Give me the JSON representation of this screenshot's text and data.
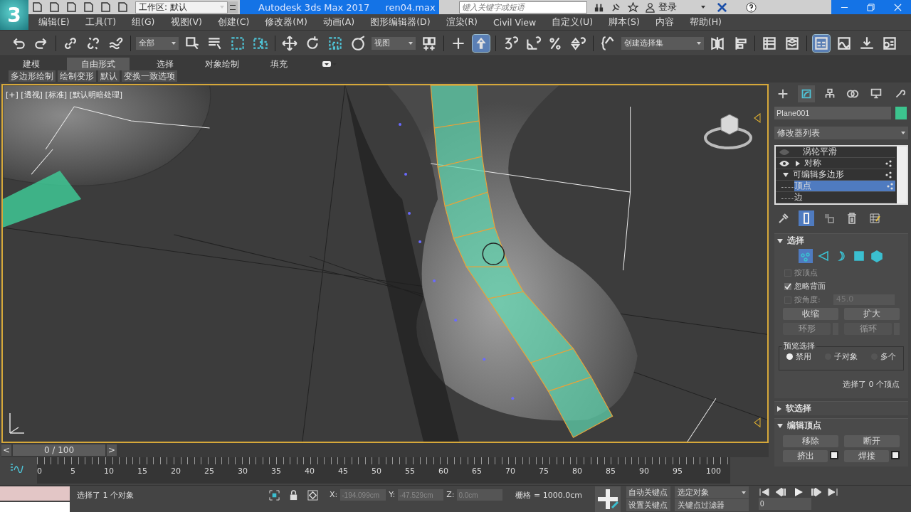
{
  "title_bar": {
    "logo": "3",
    "workspace": "工作区: 默认",
    "app_title": "Autodesk 3ds Max 2017",
    "file_name": "ren04.max",
    "search_placeholder": "键入关键字或短语",
    "login": "登录"
  },
  "menu": [
    "编辑(E)",
    "工具(T)",
    "组(G)",
    "视图(V)",
    "创建(C)",
    "修改器(M)",
    "动画(A)",
    "图形编辑器(D)",
    "渲染(R)",
    "Civil View",
    "自定义(U)",
    "脚本(S)",
    "内容",
    "帮助(H)"
  ],
  "toolbar": {
    "selection_filter": "全部",
    "reference_coordinates": "视图",
    "named_selection": "创建选择集",
    "keyboard_override": {
      "on": true
    },
    "ribbon_toggle": {
      "on": true
    }
  },
  "ribbon_tabs": [
    {
      "label": "建模",
      "selected": false
    },
    {
      "label": "自由形式",
      "selected": true
    },
    {
      "label": "选择",
      "selected": false
    },
    {
      "label": "对象绘制",
      "selected": false
    },
    {
      "label": "填充",
      "selected": false
    }
  ],
  "ribbon_panels": [
    "多边形绘制",
    "绘制变形",
    "默认",
    "变换一致选项"
  ],
  "viewport": {
    "label": "[+] [透视] [标准] [默认明暗处理]"
  },
  "command_tabs": [
    {
      "selected": false
    },
    {
      "selected": true
    },
    {
      "selected": false
    },
    {
      "selected": false
    },
    {
      "selected": false
    },
    {
      "selected": false
    }
  ],
  "object": {
    "name": "Plane001",
    "color": "#3cc48e"
  },
  "modifier_list": "修改器列表",
  "modifier_stack": [
    {
      "label": "涡轮平滑",
      "visible": false
    },
    {
      "label": "对称",
      "visible": true,
      "expanded": false
    },
    {
      "label": "可编辑多边形",
      "expanded": true,
      "children": [
        {
          "label": "顶点",
          "selected": true
        },
        {
          "label": "边",
          "selected": false
        }
      ]
    }
  ],
  "selection_rollout": {
    "title": "选择",
    "expanded": true,
    "levels": [
      {
        "selected": true
      },
      {
        "selected": false
      },
      {
        "selected": false
      },
      {
        "selected": false
      },
      {
        "selected": false
      }
    ],
    "checkboxes": [
      {
        "label": "按顶点",
        "checked": false,
        "disabled": true
      },
      {
        "label": "忽略背面",
        "checked": true,
        "disabled": false
      },
      {
        "label": "按角度:",
        "checked": false,
        "disabled": true,
        "value": "45.0"
      }
    ],
    "buttons": [
      {
        "label": "收缩",
        "kind": "plain",
        "disabled": false
      },
      {
        "label": "扩大",
        "kind": "plain",
        "disabled": false
      },
      {
        "label": "环形",
        "kind": "spinner",
        "disabled": true
      },
      {
        "label": "循环",
        "kind": "spinner",
        "disabled": true
      }
    ],
    "preview_title": "预览选择",
    "preview_options": [
      {
        "label": "禁用",
        "selected": true
      },
      {
        "label": "子对象",
        "selected": false
      },
      {
        "label": "多个",
        "selected": false
      }
    ],
    "status": "选择了 0 个顶点"
  },
  "rollouts": [
    {
      "title": "软选择",
      "expanded": false
    },
    {
      "title": "编辑顶点",
      "expanded": true,
      "buttons": [
        {
          "label": "移除",
          "kind": "plain"
        },
        {
          "label": "断开",
          "kind": "plain"
        },
        {
          "label": "挤出",
          "kind": "settings"
        },
        {
          "label": "焊接",
          "kind": "settings"
        }
      ]
    }
  ],
  "time_slider": {
    "prev": "<",
    "position": "0 / 100",
    "next": ">",
    "level": 0
  },
  "track_labels": [
    "0",
    "5",
    "10",
    "15",
    "20",
    "25",
    "30",
    "35",
    "40",
    "45",
    "50",
    "55",
    "60",
    "65",
    "70",
    "75",
    "80",
    "85",
    "90",
    "95",
    "100"
  ],
  "status_bar": {
    "message": "选择了 1 个对象",
    "x_label": "X:",
    "x": "-194.099cm",
    "y_label": "Y:",
    "y": "-47.529cm",
    "z_label": "Z:",
    "z": "0.0cm",
    "grid": "栅格 = 1000.0cm",
    "auto_key": "自动关键点",
    "key_mode": "选定对象",
    "set_key": "设置关键点",
    "key_filters": "关键点过滤器",
    "frame": "0"
  }
}
